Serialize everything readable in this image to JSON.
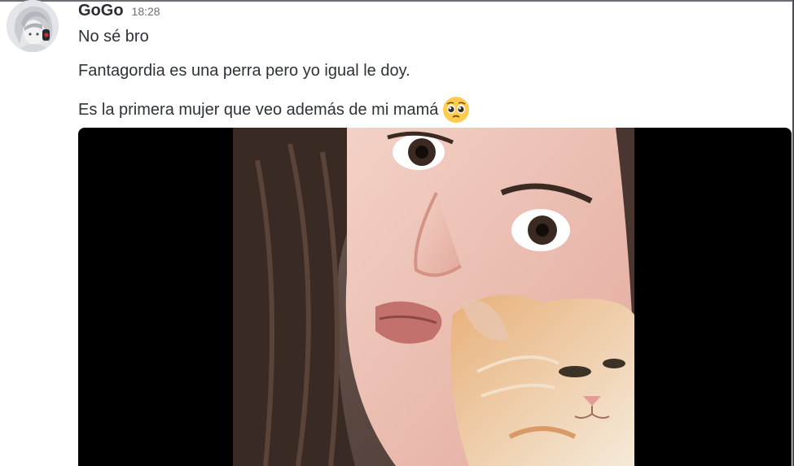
{
  "message": {
    "author": "GoGo",
    "timestamp": "18:28",
    "lines": [
      "No sé bro",
      "Fantagordia es una perra pero yo igual le doy.",
      "Es la primera mujer que veo además de mi mamá"
    ],
    "emoji": "pleading-face-icon",
    "attachment": {
      "type": "image",
      "description_icon": "photo-attachment"
    }
  },
  "colors": {
    "author": "#2b2d31",
    "text": "#2e3338",
    "timestamp": "#6d6f78",
    "media_background": "#000000"
  }
}
